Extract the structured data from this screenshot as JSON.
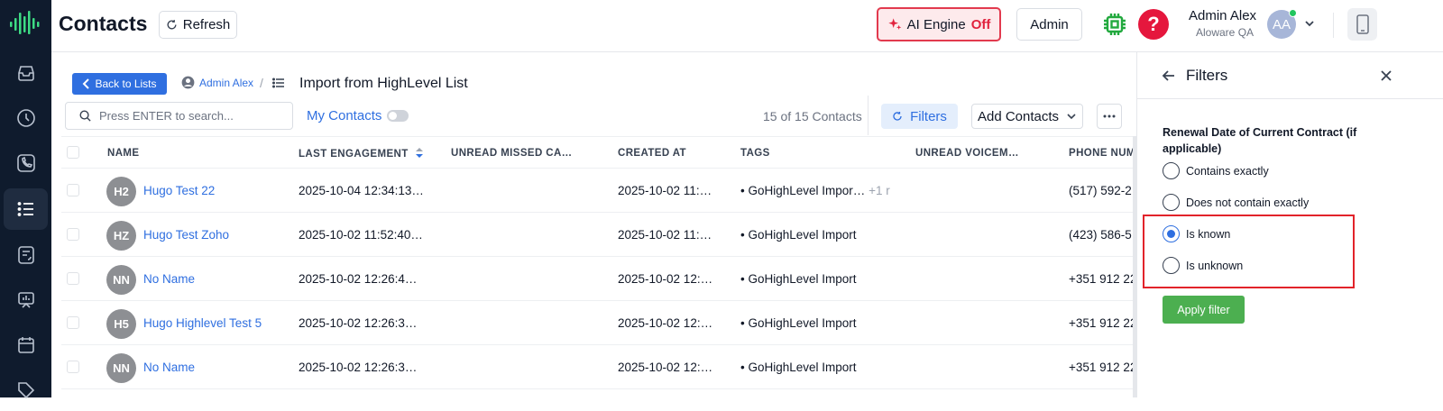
{
  "header": {
    "title": "Contacts",
    "refresh_label": "Refresh",
    "ai_engine_label": "AI Engine",
    "ai_engine_state": "Off",
    "admin_label": "Admin",
    "user_name": "Admin Alex",
    "user_org": "Aloware QA",
    "user_initials": "AA"
  },
  "sidebar": {
    "items": [
      {
        "icon": "inbox-icon"
      },
      {
        "icon": "clock-icon"
      },
      {
        "icon": "phone-icon"
      },
      {
        "icon": "list-icon",
        "active": true
      },
      {
        "icon": "contact-card-icon"
      },
      {
        "icon": "presentation-icon"
      },
      {
        "icon": "calendar-icon"
      },
      {
        "icon": "tag-icon"
      }
    ]
  },
  "breadcrumb": {
    "back_label": "Back to Lists",
    "owner": "Admin Alex",
    "separator": "/",
    "list_title": "Import from HighLevel List"
  },
  "toolbar": {
    "search_placeholder": "Press ENTER to search...",
    "my_contacts_label": "My Contacts",
    "my_contacts_on": false,
    "count_text": "15 of 15 Contacts",
    "filters_label": "Filters",
    "add_contacts_label": "Add Contacts"
  },
  "table": {
    "columns": [
      "NAME",
      "LAST ENGAGEMENT",
      "UNREAD MISSED CA…",
      "CREATED AT",
      "TAGS",
      "UNREAD VOICEM…",
      "PHONE NUM"
    ],
    "rows": [
      {
        "initials": "H2",
        "name": "Hugo Test 22",
        "last_engagement": "2025-10-04 12:34:13…",
        "created_at": "2025-10-02 11:…",
        "tag": "GoHighLevel Impor…",
        "more_tags": "+1 r",
        "phone": "(517) 592-2"
      },
      {
        "initials": "HZ",
        "name": "Hugo Test Zoho",
        "last_engagement": "2025-10-02 11:52:40…",
        "created_at": "2025-10-02 11:…",
        "tag": "GoHighLevel Import",
        "more_tags": "",
        "phone": "(423) 586-5"
      },
      {
        "initials": "NN",
        "name": "No Name",
        "last_engagement": "2025-10-02 12:26:4…",
        "created_at": "2025-10-02 12:…",
        "tag": "GoHighLevel Import",
        "more_tags": "",
        "phone": "+351 912 22"
      },
      {
        "initials": "H5",
        "name": "Hugo Highlevel Test 5",
        "last_engagement": "2025-10-02 12:26:3…",
        "created_at": "2025-10-02 12:…",
        "tag": "GoHighLevel Import",
        "more_tags": "",
        "phone": "+351 912 22"
      },
      {
        "initials": "NN",
        "name": "No Name",
        "last_engagement": "2025-10-02 12:26:3…",
        "created_at": "2025-10-02 12:…",
        "tag": "GoHighLevel Import",
        "more_tags": "",
        "phone": "+351 912 22"
      }
    ]
  },
  "filters_panel": {
    "title": "Filters",
    "field_label": "Renewal Date of Current Contract (if applicable)",
    "options": [
      {
        "label": "Contains exactly",
        "selected": false
      },
      {
        "label": "Does not contain exactly",
        "selected": false
      },
      {
        "label": "Is known",
        "selected": true
      },
      {
        "label": "Is unknown",
        "selected": false
      }
    ],
    "apply_label": "Apply filter"
  },
  "colors": {
    "sidebar_bg": "#0f1b2d",
    "accent_blue": "#2f6fe0",
    "ai_red": "#e1223d",
    "apply_green": "#4caf50",
    "highlight_red": "#e2232a",
    "logo_green": "#3ddc84"
  }
}
